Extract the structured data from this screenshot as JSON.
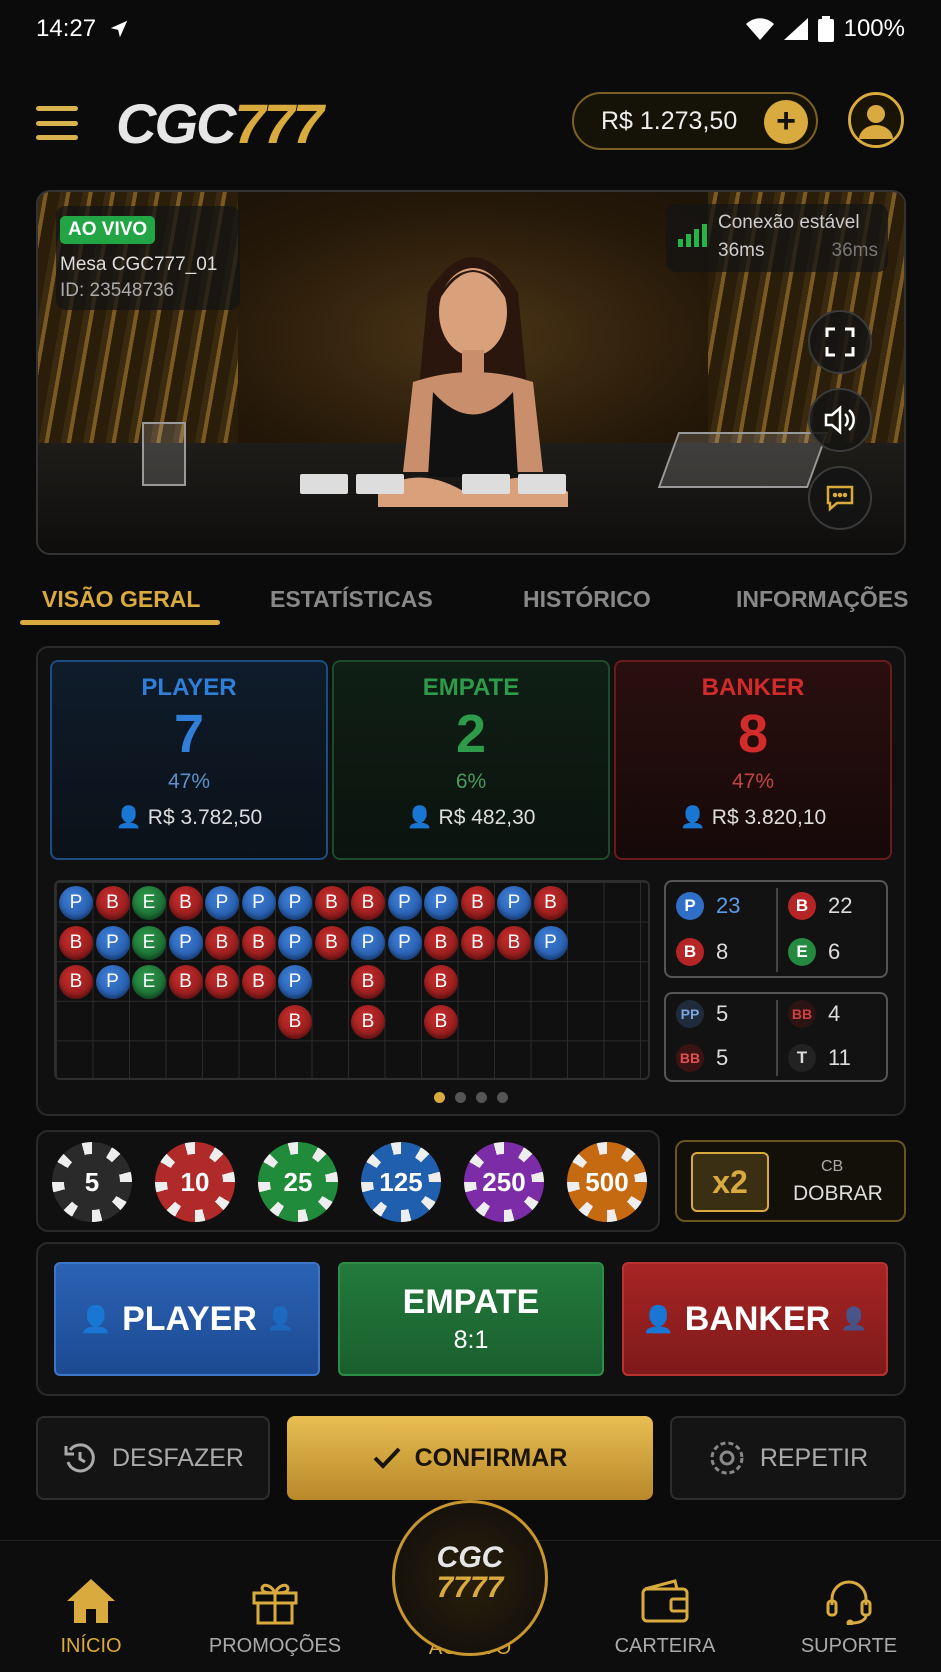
{
  "status": {
    "time": "14:27",
    "battery": "100%"
  },
  "header": {
    "logo_white": "CGC",
    "logo_gold": "777",
    "balance": "R$ 1.273,50",
    "plus": "+"
  },
  "video": {
    "live_badge": "AO VIVO",
    "table_name": "Mesa CGC777_01",
    "table_id": "ID: 23548736",
    "connection_label": "Conexão estável",
    "latency": "36ms",
    "latency_echo": "36ms"
  },
  "tabs": [
    "VISÃO GERAL",
    "ESTATÍSTICAS",
    "HISTÓRICO",
    "INFORMAÇÕES"
  ],
  "scores": {
    "player": {
      "name": "PLAYER",
      "value": "7",
      "pct": "47%",
      "amount": "R$ 3.782,50",
      "color": "#2f7fd8"
    },
    "tie": {
      "name": "EMPATE",
      "value": "2",
      "pct": "6%",
      "amount": "R$ 482,30",
      "color": "#2e9b4a"
    },
    "banker": {
      "name": "BANKER",
      "value": "8",
      "pct": "47%",
      "amount": "R$ 3.820,10",
      "color": "#d12b2b"
    }
  },
  "bead_road": [
    [
      "P",
      "B",
      "E",
      "B",
      "P",
      "P",
      "P",
      "B",
      "B",
      "P",
      "P",
      "B",
      "P",
      "B"
    ],
    [
      "B",
      "P",
      "E",
      "P",
      "B",
      "B",
      "P",
      "B",
      "P",
      "P",
      "B",
      "B",
      "B",
      "P"
    ],
    [
      "B",
      "P",
      "E",
      "B",
      "B",
      "B",
      "P",
      "",
      "B",
      "",
      "B",
      "",
      "",
      ""
    ],
    [
      "",
      "",
      "",
      "",
      "",
      "",
      "B",
      "",
      "B",
      "",
      "B",
      "",
      "",
      ""
    ]
  ],
  "road_stats": {
    "player_label": "P",
    "player_count": "23",
    "banker_label": "B",
    "banker_count": "22",
    "banker2_label": "B",
    "banker2_count": "8",
    "tie_label": "E",
    "tie_count": "6",
    "pp_label": "PP",
    "pp_count": "5",
    "bb_label": "BB",
    "bb_count": "4",
    "bb2_label": "BB",
    "bb2_count": "5",
    "t_label": "T",
    "t_count": "11"
  },
  "chips": [
    {
      "value": "5",
      "color": "#2a2a2a"
    },
    {
      "value": "10",
      "color": "#b02a2a"
    },
    {
      "value": "25",
      "color": "#1f8b3b"
    },
    {
      "value": "125",
      "color": "#1f5fae"
    },
    {
      "value": "250",
      "color": "#7d2ca8"
    },
    {
      "value": "500",
      "color": "#c66a12"
    }
  ],
  "double": {
    "badge": "x2",
    "small": "CB",
    "label": "DOBRAR"
  },
  "bets": {
    "player": {
      "label": "PLAYER"
    },
    "tie": {
      "label": "EMPATE",
      "odds": "8:1"
    },
    "banker": {
      "label": "BANKER"
    }
  },
  "actions": {
    "undo": "DESFAZER",
    "confirm": "CONFIRMAR",
    "repeat": "REPETIR"
  },
  "nav": {
    "home": "INÍCIO",
    "promos": "PROMOÇÕES",
    "live": "AO VIVO",
    "wallet": "CARTEIRA",
    "support": "SUPORTE",
    "center_logo_top": "CGC",
    "center_logo_bottom": "7777"
  }
}
